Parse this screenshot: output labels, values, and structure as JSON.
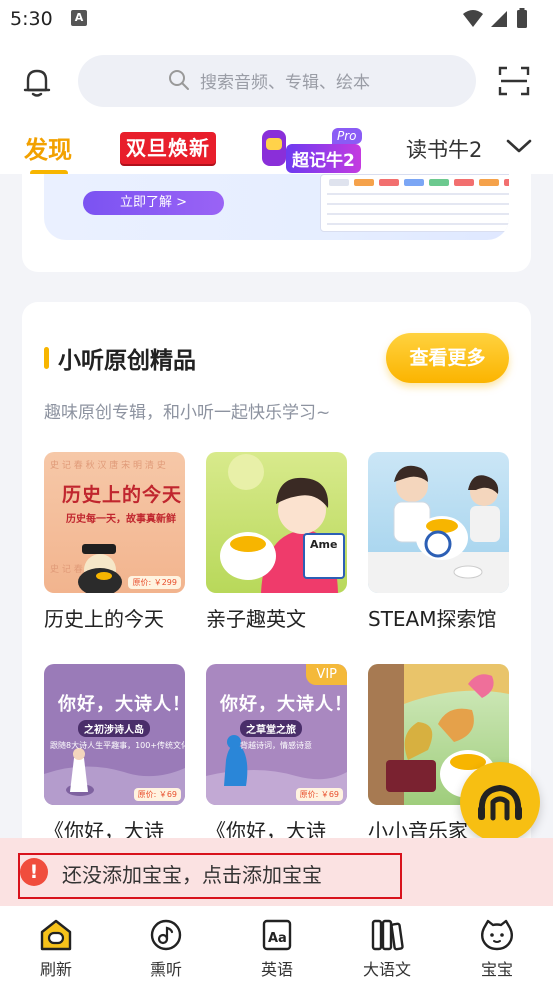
{
  "status": {
    "time": "5:30",
    "notification_glyph": "A"
  },
  "header": {
    "search_placeholder": "搜索音频、专辑、绘本"
  },
  "tabs": {
    "discover": "发现",
    "new_year": "双旦焕新",
    "chaojiniu_pro": "Pro",
    "chaojiniu": "超记牛2",
    "reading": "读书牛2"
  },
  "banner": {
    "cta": "立即了解 >"
  },
  "section": {
    "title": "小听原创精品",
    "subtitle": "趣味原创专辑，和小听一起快乐学习~",
    "more": "查看更多",
    "albums": [
      {
        "title": "历史上的今天",
        "cover_title": "历史上的今天",
        "cover_sub": "历史每一天，故事真新鲜",
        "cover_price": "原价: ￥299"
      },
      {
        "title": "亲子趣英文",
        "cover_book": "Ame"
      },
      {
        "title": "STEAM探索馆"
      },
      {
        "title": "《你好，大诗",
        "cover_title": "你好，大诗人！",
        "cover_tag": "之初涉诗人岛",
        "cover_sub": "跟随8大诗人生平趣事，100+传统文化小知识",
        "cover_price": "原价: ￥69"
      },
      {
        "title": "《你好，大诗",
        "cover_title": "你好，大诗人！",
        "cover_tag": "之草堂之旅",
        "cover_sub": "背越诗词，情感诗意",
        "cover_price": "原价: ￥69",
        "badge": "VIP"
      },
      {
        "title": "小小音乐家"
      }
    ]
  },
  "toast": {
    "icon": "!",
    "text": "还没添加宝宝，点击添加宝宝"
  },
  "bottom_nav": [
    {
      "label": "刷新",
      "icon": "home-icon"
    },
    {
      "label": "熏听",
      "icon": "music-note-icon"
    },
    {
      "label": "英语",
      "icon": "english-book-icon"
    },
    {
      "label": "大语文",
      "icon": "bookshelf-icon"
    },
    {
      "label": "宝宝",
      "icon": "baby-face-icon"
    }
  ],
  "colors": {
    "accent": "#f7b500",
    "toast_bg": "#fbe2e2",
    "highlight": "#d8121c"
  }
}
